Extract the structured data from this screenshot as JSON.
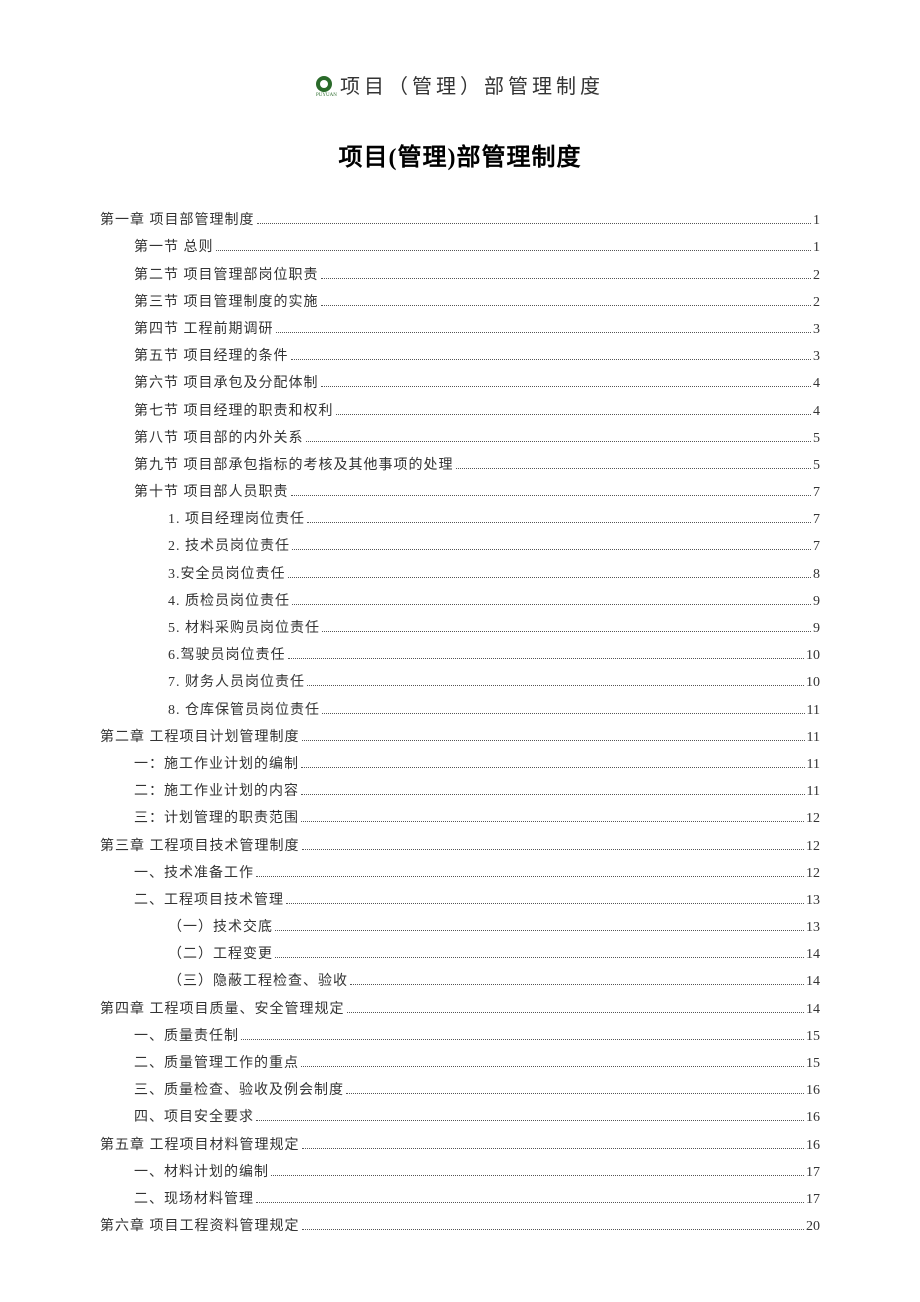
{
  "header": "项目（管理）部管理制度",
  "logo_brand": "PUYUAN",
  "title": "项目(管理)部管理制度",
  "toc": [
    {
      "level": 0,
      "label": "第一章 项目部管理制度",
      "page": "1"
    },
    {
      "level": 1,
      "label": "第一节 总则",
      "page": "1"
    },
    {
      "level": 1,
      "label": "第二节 项目管理部岗位职责",
      "page": "2"
    },
    {
      "level": 1,
      "label": "第三节 项目管理制度的实施",
      "page": "2"
    },
    {
      "level": 1,
      "label": "第四节 工程前期调研",
      "page": "3"
    },
    {
      "level": 1,
      "label": "第五节 项目经理的条件",
      "page": "3"
    },
    {
      "level": 1,
      "label": "第六节 项目承包及分配体制",
      "page": "4"
    },
    {
      "level": 1,
      "label": "第七节 项目经理的职责和权利",
      "page": "4"
    },
    {
      "level": 1,
      "label": "第八节 项目部的内外关系",
      "page": "5"
    },
    {
      "level": 1,
      "label": "第九节 项目部承包指标的考核及其他事项的处理",
      "page": "5"
    },
    {
      "level": 1,
      "label": "第十节 项目部人员职责",
      "page": "7"
    },
    {
      "level": 2,
      "label": "1. 项目经理岗位责任",
      "page": "7"
    },
    {
      "level": 2,
      "label": "2. 技术员岗位责任",
      "page": "7"
    },
    {
      "level": 2,
      "label": "3.安全员岗位责任",
      "page": "8"
    },
    {
      "level": 2,
      "label": "4. 质检员岗位责任",
      "page": "9"
    },
    {
      "level": 2,
      "label": "5. 材料采购员岗位责任",
      "page": "9"
    },
    {
      "level": 2,
      "label": "6.驾驶员岗位责任",
      "page": "10"
    },
    {
      "level": 2,
      "label": "7. 财务人员岗位责任",
      "page": "10"
    },
    {
      "level": 2,
      "label": "8. 仓库保管员岗位责任",
      "page": "11"
    },
    {
      "level": 0,
      "label": "第二章 工程项目计划管理制度",
      "page": "11"
    },
    {
      "level": 1,
      "label": "一：施工作业计划的编制",
      "page": "11"
    },
    {
      "level": 1,
      "label": "二：施工作业计划的内容",
      "page": "11"
    },
    {
      "level": 1,
      "label": "三：计划管理的职责范围",
      "page": "12"
    },
    {
      "level": 0,
      "label": "第三章 工程项目技术管理制度",
      "page": "12"
    },
    {
      "level": 1,
      "label": "一、技术准备工作",
      "page": "12"
    },
    {
      "level": 1,
      "label": "二、工程项目技术管理",
      "page": "13"
    },
    {
      "level": 3,
      "label": "（一）技术交底",
      "page": "13"
    },
    {
      "level": 3,
      "label": "（二）工程变更",
      "page": "14"
    },
    {
      "level": 3,
      "label": "（三）隐蔽工程检查、验收",
      "page": "14"
    },
    {
      "level": 0,
      "label": "第四章 工程项目质量、安全管理规定",
      "page": "14"
    },
    {
      "level": 1,
      "label": "一、质量责任制",
      "page": "15"
    },
    {
      "level": 1,
      "label": "二、质量管理工作的重点",
      "page": "15"
    },
    {
      "level": 1,
      "label": "三、质量检查、验收及例会制度",
      "page": "16"
    },
    {
      "level": 1,
      "label": "四、项目安全要求",
      "page": "16"
    },
    {
      "level": 0,
      "label": "第五章 工程项目材料管理规定",
      "page": "16"
    },
    {
      "level": 1,
      "label": "一、材料计划的编制",
      "page": "17"
    },
    {
      "level": 1,
      "label": "二、现场材料管理",
      "page": "17"
    },
    {
      "level": 0,
      "label": "第六章 项目工程资料管理规定",
      "page": "20"
    }
  ]
}
